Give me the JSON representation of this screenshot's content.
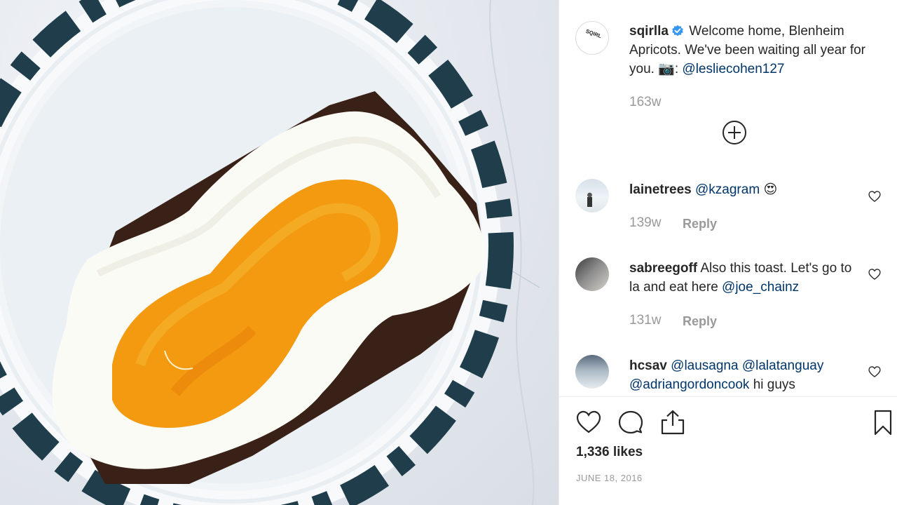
{
  "post": {
    "author": "sqirlla",
    "avatar_text": "SQIRL",
    "caption_text": "Welcome home, Blenheim Apricots. We've been waiting all year for you. 📷:",
    "caption_mention": "@lesliecohen127",
    "time": "163w"
  },
  "comments": [
    {
      "user": "lainetrees",
      "text": "",
      "mention": "@kzagram",
      "emoji": "😍",
      "time": "139w",
      "reply": "Reply"
    },
    {
      "user": "sabreegoff",
      "text": "Also this toast. Let's go to la and eat here",
      "mention": "@joe_chainz",
      "time": "131w",
      "reply": "Reply"
    },
    {
      "user": "hcsav",
      "mentions": "@lausagna @lalatanguay @adriangordoncook",
      "text": "hi guys"
    }
  ],
  "likes": "1,336 likes",
  "date": "JUNE 18, 2016",
  "colors": {
    "text": "#262626",
    "muted": "#999999",
    "link": "#003569",
    "verified": "#3897f0"
  },
  "icons": [
    "load-more-icon",
    "heart-icon",
    "comment-icon",
    "share-icon",
    "bookmark-icon",
    "verified-badge-icon"
  ]
}
